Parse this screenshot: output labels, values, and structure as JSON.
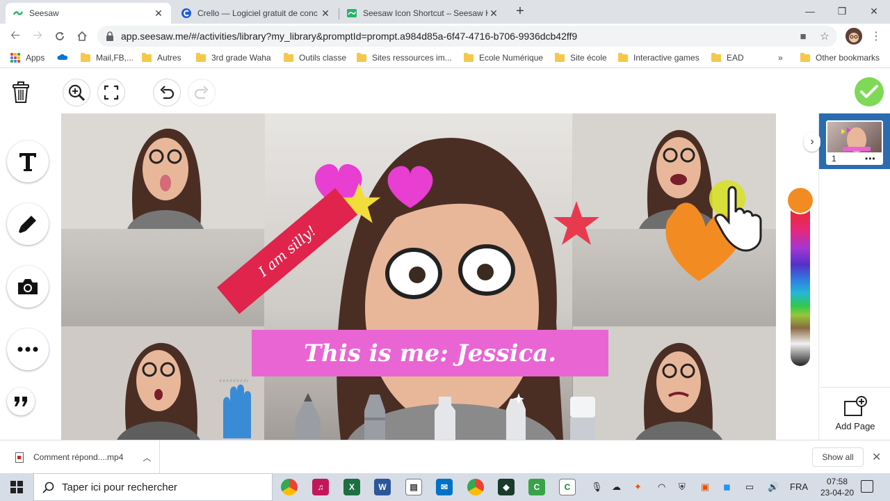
{
  "tabs": [
    {
      "title": "Seesaw",
      "active": true
    },
    {
      "title": "Crello — Logiciel gratuit de conc",
      "active": false
    },
    {
      "title": "Seesaw Icon Shortcut – Seesaw H",
      "active": false
    }
  ],
  "window_controls": {
    "minimize": "—",
    "restore": "❐",
    "close": "✕"
  },
  "address_bar": {
    "url": "app.seesaw.me/#/activities/library?my_library&promptId=prompt.a984d85a-6f47-4716-b706-9936dcb42ff9"
  },
  "bookmarks": {
    "apps": "Apps",
    "items": [
      "Mail,FB,...",
      "Autres",
      "3rd grade Waha",
      "Outils classe",
      "Sites ressources im...",
      "Ecole Numérique",
      "Site école",
      "Interactive games",
      "EAD"
    ],
    "overflow": "»",
    "other": "Other bookmarks"
  },
  "canvas": {
    "banner_text": "I am silly!",
    "caption_text": "This is me: Jessica."
  },
  "pages_panel": {
    "page_number": "1",
    "page_menu": "•••",
    "add_page_label": "Add Page"
  },
  "colors": {
    "selected": "#f28c22",
    "check": "#7ed957",
    "banner": "#e0244b",
    "caption": "#e965d4",
    "page_panel": "#2b6cb0"
  },
  "download_bar": {
    "file_name": "Comment répond....mp4",
    "show_all": "Show all"
  },
  "taskbar": {
    "search_placeholder": "Taper ici pour rechercher",
    "language": "FRA",
    "time": "07:58",
    "date": "23-04-20"
  }
}
